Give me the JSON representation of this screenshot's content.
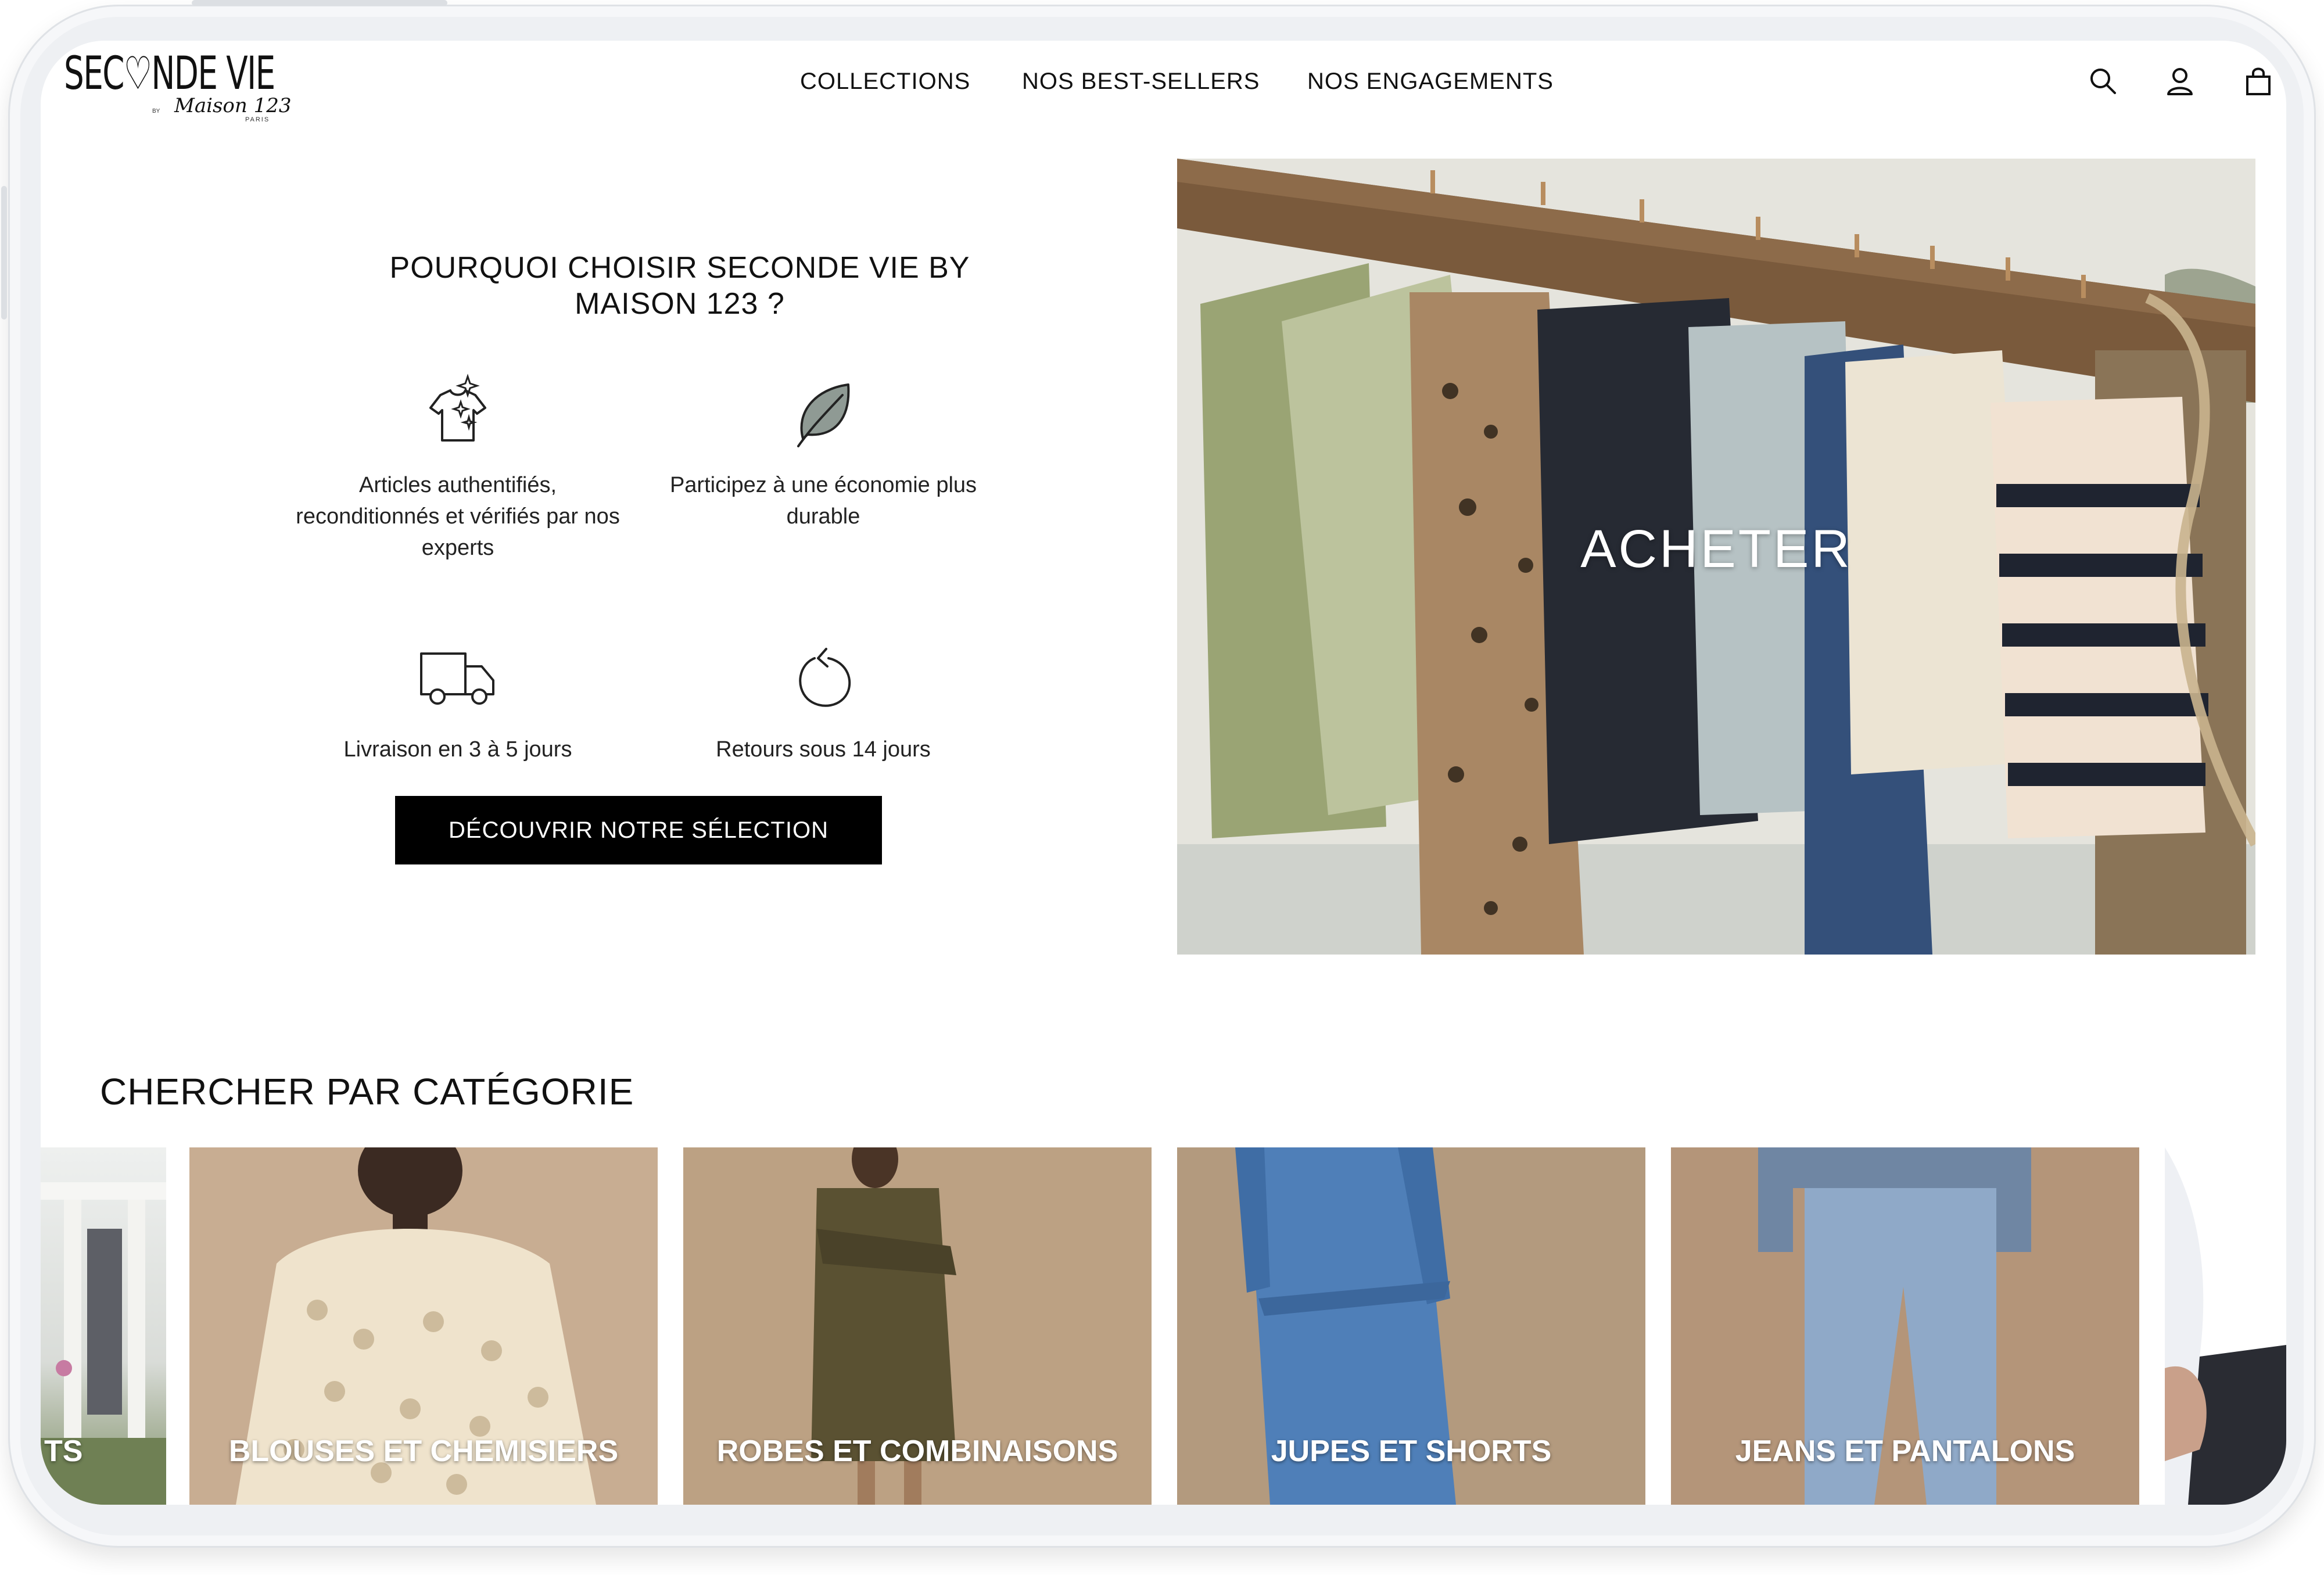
{
  "brand": {
    "logo_main": "SEC♡NDE VIE",
    "logo_by": "BY",
    "logo_sub": "Maison 123",
    "logo_city": "PARIS"
  },
  "nav": {
    "items": [
      "COLLECTIONS",
      "NOS BEST-SELLERS",
      "NOS ENGAGEMENTS"
    ]
  },
  "header_icons": [
    "search-icon",
    "account-icon",
    "cart-icon"
  ],
  "why": {
    "title_line1": "POURQUOI CHOISIR SECONDE VIE BY",
    "title_line2": "MAISON 123 ?",
    "features": [
      {
        "icon": "sparkle-tshirt-icon",
        "text": "Articles authentifiés, reconditionnés et vérifiés par nos experts"
      },
      {
        "icon": "leaf-icon",
        "text": "Participez à une économie plus durable"
      },
      {
        "icon": "delivery-truck-icon",
        "text": "Livraison en 3 à 5 jours"
      },
      {
        "icon": "return-arrow-icon",
        "text": "Retours sous 14 jours"
      }
    ],
    "cta_label": "DÉCOUVRIR NOTRE SÉLECTION"
  },
  "hero": {
    "label": "ACHETER"
  },
  "categories": {
    "title": "CHERCHER PAR CATÉGORIE",
    "items": [
      {
        "label": "TS"
      },
      {
        "label": "BLOUSES ET CHEMISIERS"
      },
      {
        "label": "ROBES ET COMBINAISONS"
      },
      {
        "label": "JUPES ET SHORTS"
      },
      {
        "label": "JEANS ET PANTALONS"
      },
      {
        "label": ""
      }
    ]
  },
  "colors": {
    "text": "#111111",
    "button_bg": "#000000",
    "button_text": "#ffffff",
    "card_beige": "#c4a98c"
  }
}
